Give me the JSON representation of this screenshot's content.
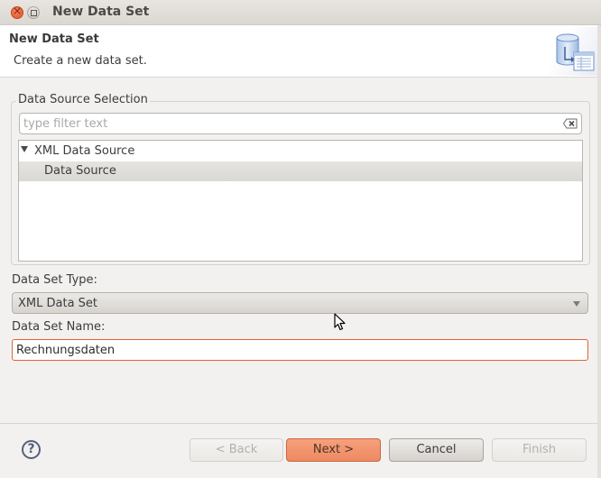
{
  "window": {
    "title": "New Data Set",
    "close_icon": "close-icon",
    "maximize_icon": "maximize-icon"
  },
  "header": {
    "title": "New Data Set",
    "description": "Create a new data set.",
    "icon": "database-table-icon"
  },
  "data_source_selection": {
    "group_label": "Data Source Selection",
    "filter": {
      "value": "",
      "placeholder": "type filter text",
      "clear_icon": "clear-filter-icon"
    },
    "tree": [
      {
        "label": "XML Data Source",
        "expanded": true,
        "children": [
          {
            "label": "Data Source",
            "selected": true
          }
        ]
      }
    ]
  },
  "data_set_type": {
    "label": "Data Set Type:",
    "selected": "XML Data Set"
  },
  "data_set_name": {
    "label": "Data Set Name:",
    "value": "Rechnungsdaten"
  },
  "footer": {
    "help_icon": "help-icon",
    "help_glyph": "?",
    "back_label": "< Back",
    "next_label": "Next >",
    "cancel_label": "Cancel",
    "finish_label": "Finish"
  },
  "colors": {
    "accent": "#ec8a62",
    "focus_border": "#e0642e",
    "background": "#f2f1f0"
  }
}
